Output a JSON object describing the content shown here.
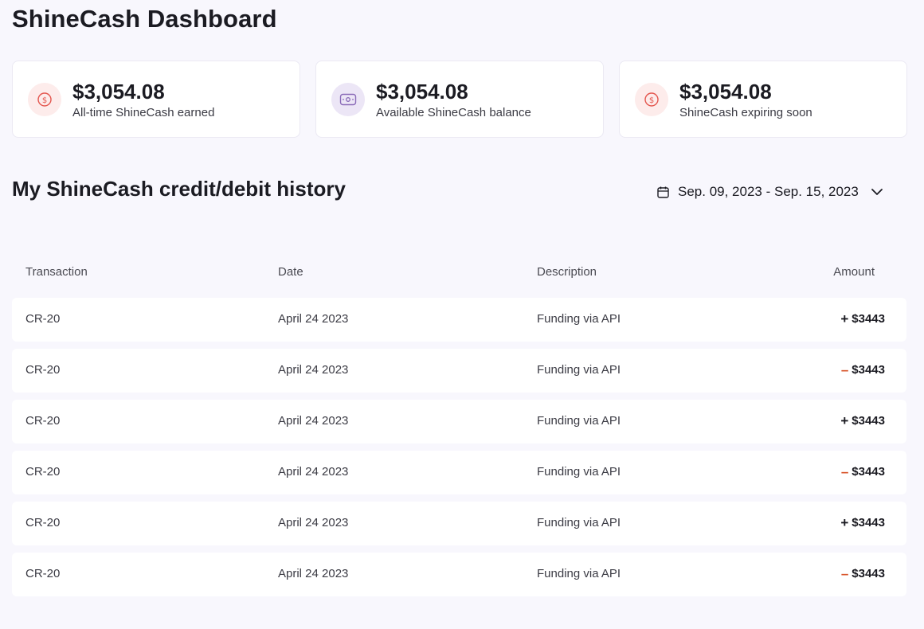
{
  "page": {
    "title": "ShineCash Dashboard"
  },
  "stats": [
    {
      "value": "$3,054.08",
      "label": "All-time ShineCash earned",
      "icon": "coin-icon"
    },
    {
      "value": "$3,054.08",
      "label": "Available ShineCash balance",
      "icon": "wallet-icon"
    },
    {
      "value": "$3,054.08",
      "label": "ShineCash expiring soon",
      "icon": "coin-icon"
    }
  ],
  "history": {
    "title": "My ShineCash credit/debit history",
    "date_range": "Sep. 09, 2023 - Sep. 15, 2023",
    "columns": {
      "transaction": "Transaction",
      "date": "Date",
      "description": "Description",
      "amount": "Amount"
    },
    "rows": [
      {
        "transaction": "CR-20",
        "date": "April 24 2023",
        "description": "Funding via API",
        "sign": "+",
        "amount": "$3443"
      },
      {
        "transaction": "CR-20",
        "date": "April 24 2023",
        "description": "Funding via API",
        "sign": "–",
        "amount": "$3443"
      },
      {
        "transaction": "CR-20",
        "date": "April 24 2023",
        "description": "Funding via API",
        "sign": "+",
        "amount": "$3443"
      },
      {
        "transaction": "CR-20",
        "date": "April 24 2023",
        "description": "Funding via API",
        "sign": "–",
        "amount": "$3443"
      },
      {
        "transaction": "CR-20",
        "date": "April 24 2023",
        "description": "Funding via API",
        "sign": "+",
        "amount": "$3443"
      },
      {
        "transaction": "CR-20",
        "date": "April 24 2023",
        "description": "Funding via API",
        "sign": "–",
        "amount": "$3443"
      }
    ]
  },
  "colors": {
    "background": "#f8f7fd",
    "credit_sign": "#1b1b22",
    "debit_sign": "#d8552b",
    "coin_icon": "#e4564e",
    "wallet_icon": "#8a6bb8"
  }
}
